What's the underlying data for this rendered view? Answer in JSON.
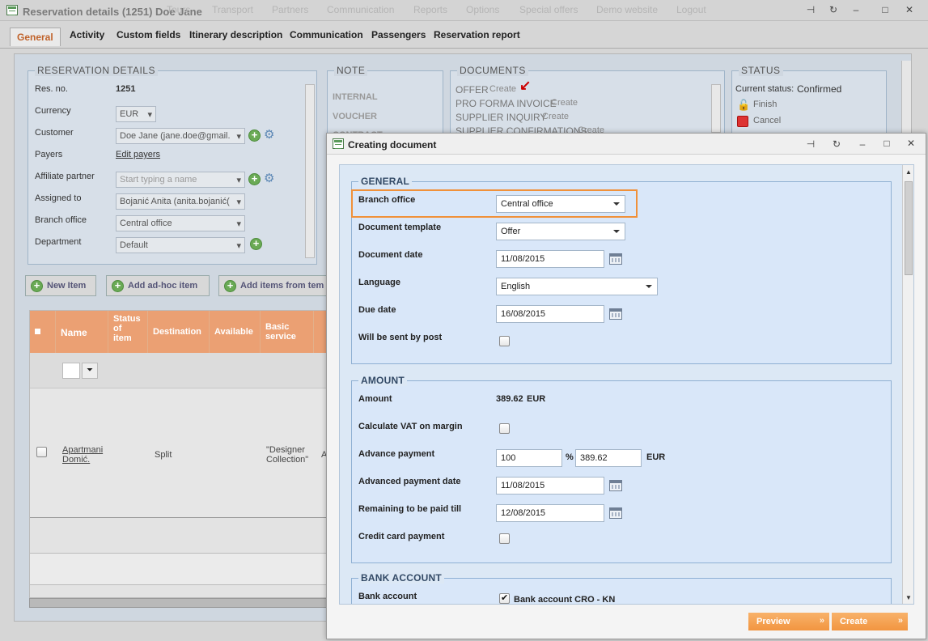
{
  "background": {
    "title": "Reservation details (1251) Doe Jane",
    "menu": [
      "Tours",
      "Transport",
      "Partners",
      "Communication",
      "Reports",
      "Options",
      "Special offers",
      "Demo website",
      "Logout"
    ],
    "tabs": [
      "General",
      "Activity",
      "Custom fields",
      "Itinerary description",
      "Communication",
      "Passengers",
      "Reservation report"
    ],
    "reservation_details": {
      "legend": "RESERVATION DETAILS",
      "res_no_label": "Res. no.",
      "res_no": "1251",
      "currency_label": "Currency",
      "currency": "EUR",
      "customer_label": "Customer",
      "customer": "Doe Jane (jane.doe@gmail.",
      "payers_label": "Payers",
      "payers_link": "Edit payers",
      "affiliate_label": "Affiliate partner",
      "affiliate_placeholder": "Start typing a name",
      "assigned_label": "Assigned to",
      "assigned": "Bojanić Anita (anita.bojanić(",
      "branch_label": "Branch office",
      "branch": "Central office",
      "department_label": "Department",
      "department": "Default"
    },
    "note": {
      "legend": "NOTE",
      "items": [
        "INTERNAL",
        "VOUCHER",
        "CONTRACT"
      ]
    },
    "documents": {
      "legend": "DOCUMENTS",
      "items": [
        {
          "name": "OFFER",
          "action": "Create"
        },
        {
          "name": "PRO FORMA INVOICE",
          "action": "Create"
        },
        {
          "name": "SUPPLIER INQUIRY",
          "action": "Create"
        },
        {
          "name": "SUPPLIER CONFIRMATIONS",
          "action": "Create"
        }
      ]
    },
    "status": {
      "legend": "STATUS",
      "current_label": "Current status:",
      "current": "Confirmed",
      "finish": "Finish",
      "cancel": "Cancel"
    },
    "buttons": {
      "new_item": "New Item",
      "add_adhoc": "Add ad-hoc item",
      "add_template": "Add items from tem"
    },
    "table": {
      "headers": [
        "Name",
        "Status of item",
        "Destination",
        "Available",
        "Basic service"
      ],
      "row": {
        "name": "Apartmani Domić.",
        "destination": "Split",
        "service": "\"Designer Collection\"",
        "extra": "A"
      }
    }
  },
  "dialog": {
    "title": "Creating document",
    "general": {
      "legend": "GENERAL",
      "branch_label": "Branch office",
      "branch": "Central office",
      "template_label": "Document template",
      "template": "Offer",
      "date_label": "Document date",
      "date": "11/08/2015",
      "language_label": "Language",
      "language": "English",
      "due_label": "Due date",
      "due": "16/08/2015",
      "post_label": "Will be sent by post"
    },
    "amount": {
      "legend": "AMOUNT",
      "amount_label": "Amount",
      "amount": "389.62",
      "amount_currency": "EUR",
      "vat_label": "Calculate VAT on margin",
      "advance_label": "Advance payment",
      "advance_percent": "100",
      "percent_sign": "%",
      "advance_value": "389.62",
      "advance_currency": "EUR",
      "advance_date_label": "Advanced payment date",
      "advance_date": "11/08/2015",
      "remaining_label": "Remaining to be paid till",
      "remaining_date": "12/08/2015",
      "credit_label": "Credit card payment"
    },
    "bank": {
      "legend": "BANK ACCOUNT",
      "label": "Bank account",
      "value": "Bank account CRO - KN"
    },
    "buttons": {
      "preview": "Preview",
      "create": "Create"
    }
  }
}
